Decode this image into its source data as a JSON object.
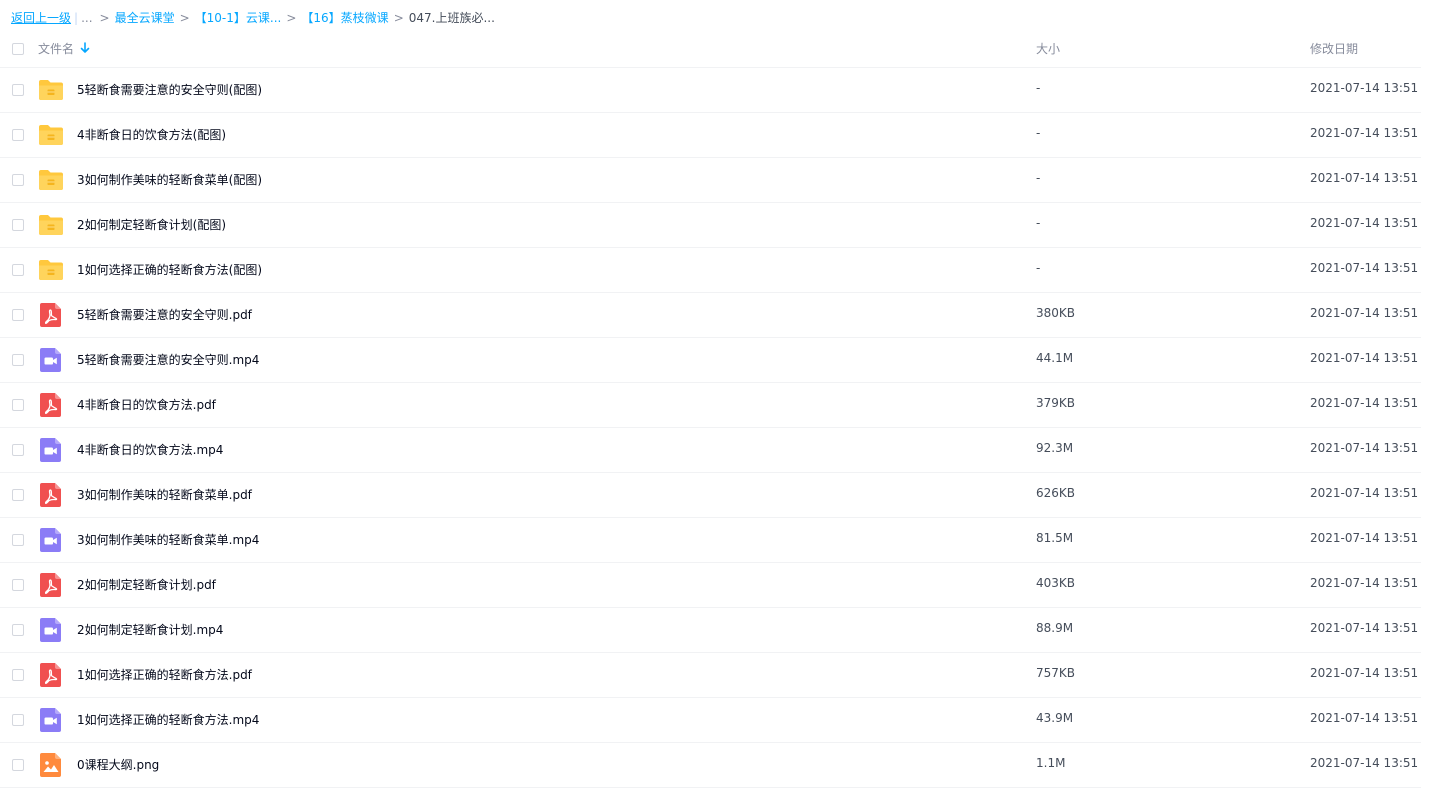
{
  "breadcrumb": {
    "back": "返回上一级",
    "ellipsis": "...",
    "items": [
      "最全云课堂",
      "【10-1】云课...",
      "【16】蒸枝微课"
    ],
    "current": "047.上班族必..."
  },
  "header": {
    "name": "文件名",
    "size": "大小",
    "date": "修改日期"
  },
  "colors": {
    "folder": "#ffc83d",
    "pdf": "#f05050",
    "video": "#8b7cf6",
    "image": "#ff8a3d",
    "link": "#06a7ff"
  },
  "files": [
    {
      "type": "folder",
      "icon": "folder-icon",
      "name": "5轻断食需要注意的安全守则(配图)",
      "size": "-",
      "date": "2021-07-14 13:51"
    },
    {
      "type": "folder",
      "icon": "folder-icon",
      "name": "4非断食日的饮食方法(配图)",
      "size": "-",
      "date": "2021-07-14 13:51"
    },
    {
      "type": "folder",
      "icon": "folder-icon",
      "name": "3如何制作美味的轻断食菜单(配图)",
      "size": "-",
      "date": "2021-07-14 13:51"
    },
    {
      "type": "folder",
      "icon": "folder-icon",
      "name": "2如何制定轻断食计划(配图)",
      "size": "-",
      "date": "2021-07-14 13:51"
    },
    {
      "type": "folder",
      "icon": "folder-icon",
      "name": "1如何选择正确的轻断食方法(配图)",
      "size": "-",
      "date": "2021-07-14 13:51"
    },
    {
      "type": "pdf",
      "icon": "pdf-icon",
      "name": "5轻断食需要注意的安全守则.pdf",
      "size": "380KB",
      "date": "2021-07-14 13:51"
    },
    {
      "type": "video",
      "icon": "video-icon",
      "name": "5轻断食需要注意的安全守则.mp4",
      "size": "44.1M",
      "date": "2021-07-14 13:51"
    },
    {
      "type": "pdf",
      "icon": "pdf-icon",
      "name": "4非断食日的饮食方法.pdf",
      "size": "379KB",
      "date": "2021-07-14 13:51"
    },
    {
      "type": "video",
      "icon": "video-icon",
      "name": "4非断食日的饮食方法.mp4",
      "size": "92.3M",
      "date": "2021-07-14 13:51"
    },
    {
      "type": "pdf",
      "icon": "pdf-icon",
      "name": "3如何制作美味的轻断食菜单.pdf",
      "size": "626KB",
      "date": "2021-07-14 13:51"
    },
    {
      "type": "video",
      "icon": "video-icon",
      "name": "3如何制作美味的轻断食菜单.mp4",
      "size": "81.5M",
      "date": "2021-07-14 13:51"
    },
    {
      "type": "pdf",
      "icon": "pdf-icon",
      "name": "2如何制定轻断食计划.pdf",
      "size": "403KB",
      "date": "2021-07-14 13:51"
    },
    {
      "type": "video",
      "icon": "video-icon",
      "name": "2如何制定轻断食计划.mp4",
      "size": "88.9M",
      "date": "2021-07-14 13:51"
    },
    {
      "type": "pdf",
      "icon": "pdf-icon",
      "name": "1如何选择正确的轻断食方法.pdf",
      "size": "757KB",
      "date": "2021-07-14 13:51"
    },
    {
      "type": "video",
      "icon": "video-icon",
      "name": "1如何选择正确的轻断食方法.mp4",
      "size": "43.9M",
      "date": "2021-07-14 13:51"
    },
    {
      "type": "image",
      "icon": "image-icon",
      "name": "0课程大纲.png",
      "size": "1.1M",
      "date": "2021-07-14 13:51"
    }
  ]
}
